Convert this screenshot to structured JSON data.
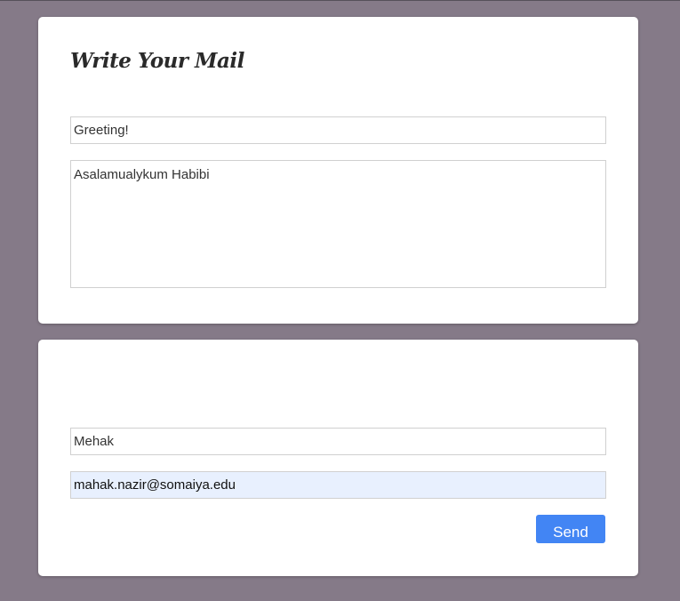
{
  "compose": {
    "title": "Write Your Mail",
    "subject": "Greeting!",
    "message": "Asalamualykum Habibi"
  },
  "sender": {
    "name": "Mehak",
    "email": "mahak.nazir@somaiya.edu",
    "send_label": "Send"
  },
  "colors": {
    "background": "#857a88",
    "card": "#ffffff",
    "button": "#4285f4",
    "autofill": "#e8f0fe"
  }
}
